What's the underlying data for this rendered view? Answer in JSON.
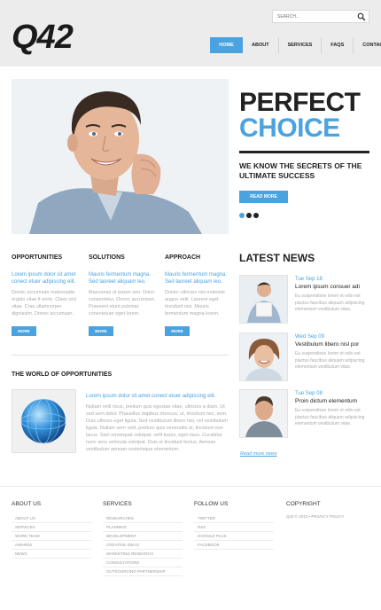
{
  "logo": "Q42",
  "search": {
    "placeholder": "SEARCH..."
  },
  "nav": [
    "HOME",
    "ABOUT",
    "SERVICES",
    "FAQS",
    "CONTACTS"
  ],
  "hero": {
    "title1": "PERFECT",
    "title2": "CHOICE",
    "subtitle": "WE KNOW THE SECRETS OF THE ULTIMATE SUCCESS",
    "button": "READ MORE"
  },
  "columns": [
    {
      "title": "OPPORTUNITIES",
      "lead": "Lorem ipsum dolor sit amet conect etuer adipiscing elit.",
      "body": "Donec accumsan malesuada orgido vitae lt enim. Class orci vitae. Cras ullamcorper dignissim. Donec accumsan.",
      "button": "MORE"
    },
    {
      "title": "SOLUTIONS",
      "lead": "Mauris fermentum magna. Sed laoreet aliquam leo.",
      "body": "Maecenas ut ipsum sen. Dolor consectetur. Donec accumsan. Praesent etunt pulvinar conectetuer eget lorem.",
      "button": "MORE"
    },
    {
      "title": "APPROACH",
      "lead": "Mauris fermentum magna. Sed laoreet aliquam leo.",
      "body": "Donec ultricies nisi molestie augue velit. Laoreet eget tincidunt nisi. Mauris fermentum magna lorem.",
      "button": "MORE"
    }
  ],
  "world": {
    "title": "THE WORLD OF OPPORTUNITIES",
    "lead": "Lorem ipsum dolor sit amet conect etuer adipiscing elit.",
    "body": "Nullam velit risus, pretium quis egestas vitae, ultricies a diam. Ut sed sem dolor. Phasellus dapibus rhoncus, ut, tincidunt nec, sem. Duis ultrices eget ligula. Sed vestibulum libero nisi, vel vestibulum ligula. Nullam sem velit, pretium quis venenatis at, tincidunt non lacus. Sed consequat volutpat, velit turpis, eget risus. Curabitur nunc arcu vehicula volutpat. Duis ut tincidunt lectus. Aenean vestibulum aenean scelerisque elementum."
  },
  "news": {
    "title": "LATEST NEWS",
    "items": [
      {
        "date": "Tue Sep 18",
        "headline": "Lorem ipsum consuer adi",
        "body": "Eu suspendisse lorem et odio est plactus faucibus aliquam adipiscing elementum vestibulum vitae."
      },
      {
        "date": "Wed Sep 09",
        "headline": "Vestibulum libero nisl por",
        "body": "Eu suspendisse lorem et odio est plactus faucibus aliquam adipiscing elementum vestibulum vitae."
      },
      {
        "date": "Tue Sep 08",
        "headline": "Proin dictum elementum",
        "body": "Eu suspendisse lorem et odio est plactus faucibus aliquam adipiscing elementum vestibulum vitae."
      }
    ],
    "read_more": "Read more news"
  },
  "footer": {
    "about": {
      "title": "ABOUT US",
      "links": [
        "ABOUT US",
        "SERVICES",
        "WORK TEAM",
        "AWARDS",
        "NEWS"
      ]
    },
    "services": {
      "title": "SERVICES",
      "links": [
        "RESEARCHES",
        "PLANNING",
        "DEVELOPMENT",
        "CREATIVE IDEAS",
        "MARKETING RESEARCH",
        "CONSULTATIONS",
        "OUTSOURCING PARTNERSHIP"
      ]
    },
    "follow": {
      "title": "FOLLOW US",
      "links": [
        "TWITTER",
        "RSS",
        "GOOGLE PLUS",
        "FACEBOOK"
      ]
    },
    "copyright": {
      "title": "COPYRIGHT",
      "text": "Q42 © 2013 • PRIVACY POLICY"
    }
  },
  "colors": {
    "accent": "#4aa3df",
    "dark": "#222222",
    "header_bg": "#ececec"
  },
  "icons": {
    "search": "search-icon"
  }
}
